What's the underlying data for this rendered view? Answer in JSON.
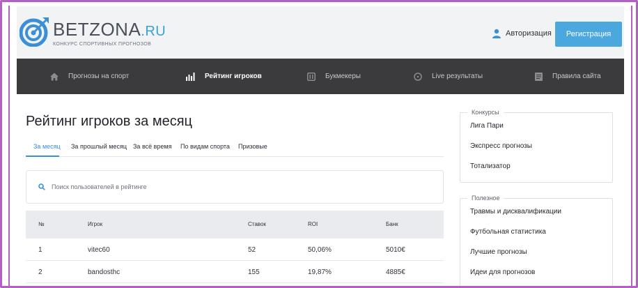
{
  "header": {
    "logo_name": "BETZONA",
    "logo_tld": ".RU",
    "logo_tagline": "КОНКУРС СПОРТИВНЫХ ПРОГНОЗОВ",
    "auth_label": "Авторизация",
    "register_label": "Регистрация"
  },
  "nav": {
    "items": [
      {
        "label": "Прогнозы на спорт",
        "icon": "home-icon"
      },
      {
        "label": "Рейтинг игроков",
        "icon": "bar-chart-icon"
      },
      {
        "label": "Букмекеры",
        "icon": "bookmaker-icon"
      },
      {
        "label": "Live результаты",
        "icon": "clock-icon"
      },
      {
        "label": "Правила сайта",
        "icon": "document-icon"
      }
    ]
  },
  "main": {
    "title": "Рейтинг игроков за месяц",
    "tabs": [
      {
        "label": "За месяц",
        "active": true
      },
      {
        "label": "За прошлый месяц",
        "active": false
      },
      {
        "label": "За всё время",
        "active": false
      },
      {
        "label": "По видам спорта",
        "active": false
      },
      {
        "label": "Призовые",
        "active": false
      }
    ],
    "search_placeholder": "Поиск пользователей в рейтинге"
  },
  "table": {
    "headers": [
      "№",
      "Игрок",
      "Ставок",
      "ROI",
      "Банк"
    ],
    "rows": [
      [
        "1",
        "vitec60",
        "52",
        "50,06%",
        "5010€"
      ],
      [
        "2",
        "bandosthc",
        "155",
        "19,87%",
        "4885€"
      ]
    ]
  },
  "sidebar": {
    "contests": {
      "title": "Конкурсы",
      "items": [
        "Лига Пари",
        "Экспресс прогнозы",
        "Тотализатор"
      ]
    },
    "useful": {
      "title": "Полезное",
      "items": [
        "Травмы и дисквалификации",
        "Футбольная статистика",
        "Лучшие прогнозы",
        "Идеи для прогнозов"
      ]
    }
  },
  "colors": {
    "accent": "#3a8fd6",
    "register_button": "#4aa8de",
    "nav_background": "#3b3b3d",
    "frame": "#b35fc4"
  }
}
